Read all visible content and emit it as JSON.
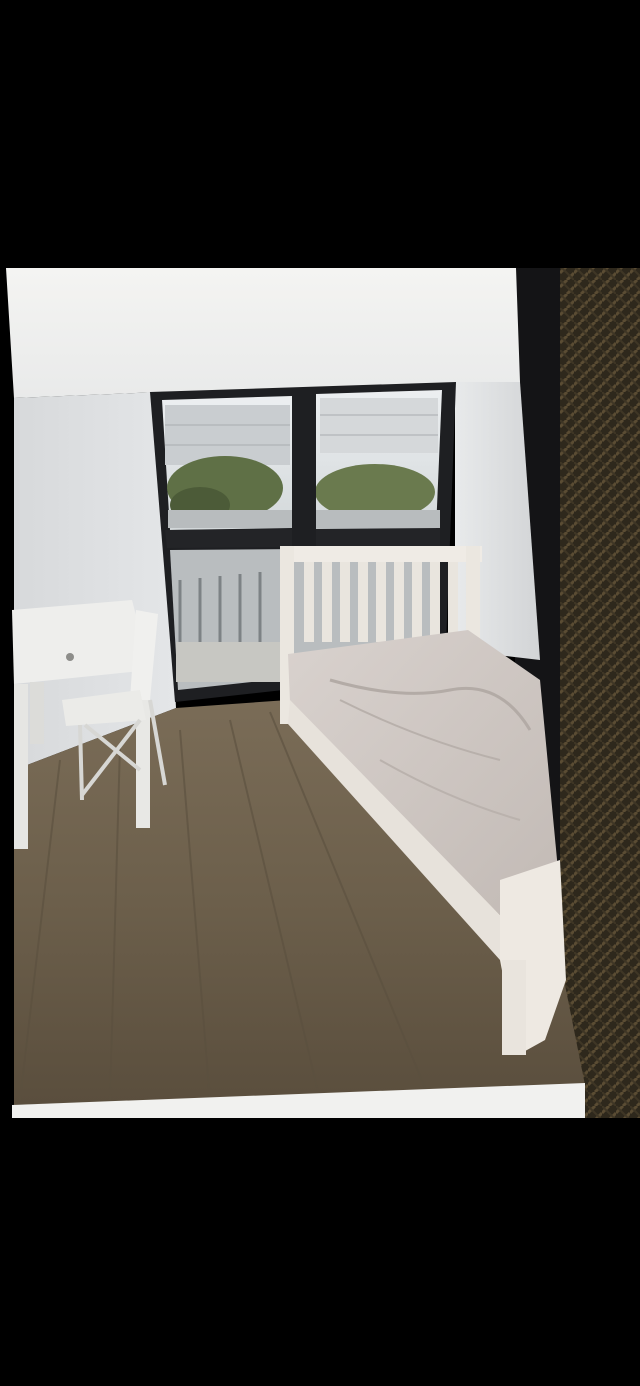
{
  "image": {
    "subject": "bedroom-photo",
    "colors": {
      "background": "#000000",
      "wall": "#e6e8ea",
      "floor": "#6e6250",
      "bed_frame": "#eeeae4",
      "mattress": "#cfc8c4",
      "window_frame": "#1e1f22",
      "backing_texture": "#3a3222"
    }
  }
}
